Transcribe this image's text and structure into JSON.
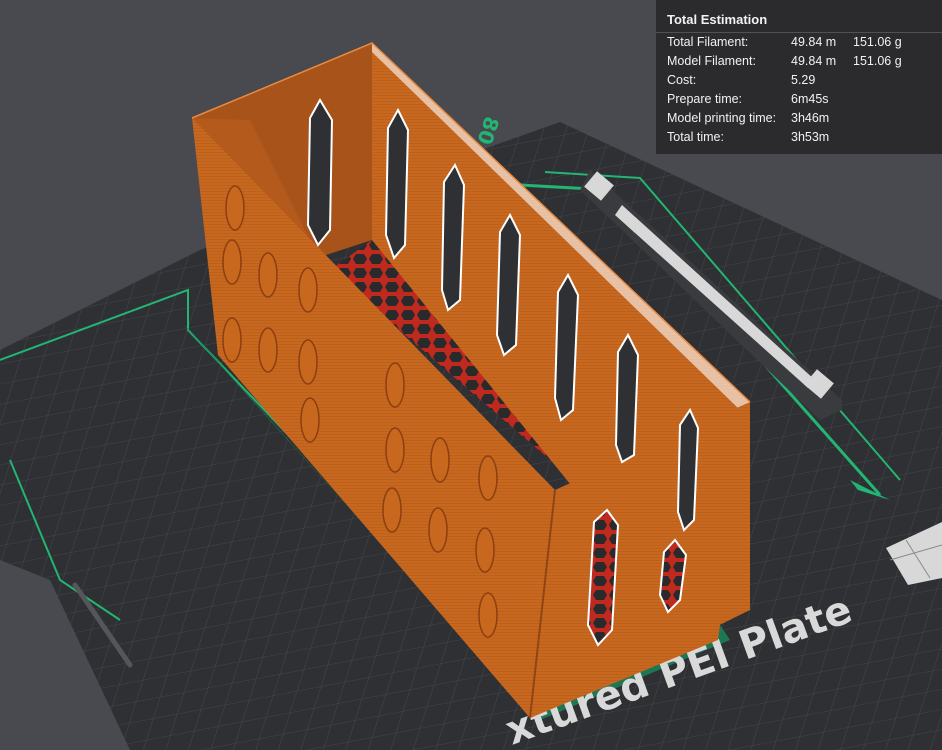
{
  "viewport": {
    "plate_label": "xtured PEI Plate",
    "axis_label": "80",
    "colors": {
      "background": "#494a4f",
      "plate": "#2f3033",
      "grid": "#45464a",
      "model": "#c8681f",
      "model_shadow": "#a8531a",
      "accent": "#22b573"
    }
  },
  "estimation": {
    "title": "Total Estimation",
    "rows": [
      {
        "label": "Total Filament:",
        "value": "49.84 m",
        "value2": "151.06 g"
      },
      {
        "label": "Model Filament:",
        "value": "49.84 m",
        "value2": "151.06 g"
      },
      {
        "label": "Cost:",
        "value": "5.29",
        "value2": ""
      },
      {
        "label": "Prepare time:",
        "value": "6m45s",
        "value2": ""
      },
      {
        "label": "Model printing time:",
        "value": "3h46m",
        "value2": ""
      },
      {
        "label": "Total time:",
        "value": "3h53m",
        "value2": ""
      }
    ]
  }
}
